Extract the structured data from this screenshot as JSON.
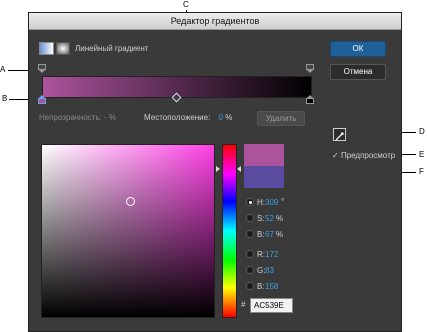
{
  "callouts": {
    "A": "A",
    "B": "B",
    "C": "C",
    "D": "D",
    "E": "E",
    "F": "F"
  },
  "dialog": {
    "title": "Редактор градиентов",
    "gradient_type_label": "Линейный градиент",
    "ok_label": "ОК",
    "cancel_label": "Отмена",
    "opacity_label": "Непрозрачность:",
    "opacity_value": "-",
    "opacity_unit": "%",
    "location_label": "Местоположение:",
    "location_value": "0",
    "location_unit": "%",
    "delete_label": "Удалить",
    "preview_label": "Предпросмотр",
    "preview_checked": true
  },
  "gradient": {
    "start_color": "#ac539e",
    "end_color": "#000000"
  },
  "swatches": {
    "new_color": "#ac539e",
    "original_color": "#5a4aa0"
  },
  "channels": {
    "h": {
      "label": "H:",
      "value": "309",
      "unit": "°"
    },
    "s": {
      "label": "S:",
      "value": "52",
      "unit": "%"
    },
    "b": {
      "label": "B:",
      "value": "67",
      "unit": "%"
    },
    "r": {
      "label": "R:",
      "value": "172"
    },
    "g": {
      "label": "G:",
      "value": "83"
    },
    "bl": {
      "label": "B:",
      "value": "158"
    }
  },
  "hex": {
    "label": "#",
    "value": "AC539E"
  }
}
